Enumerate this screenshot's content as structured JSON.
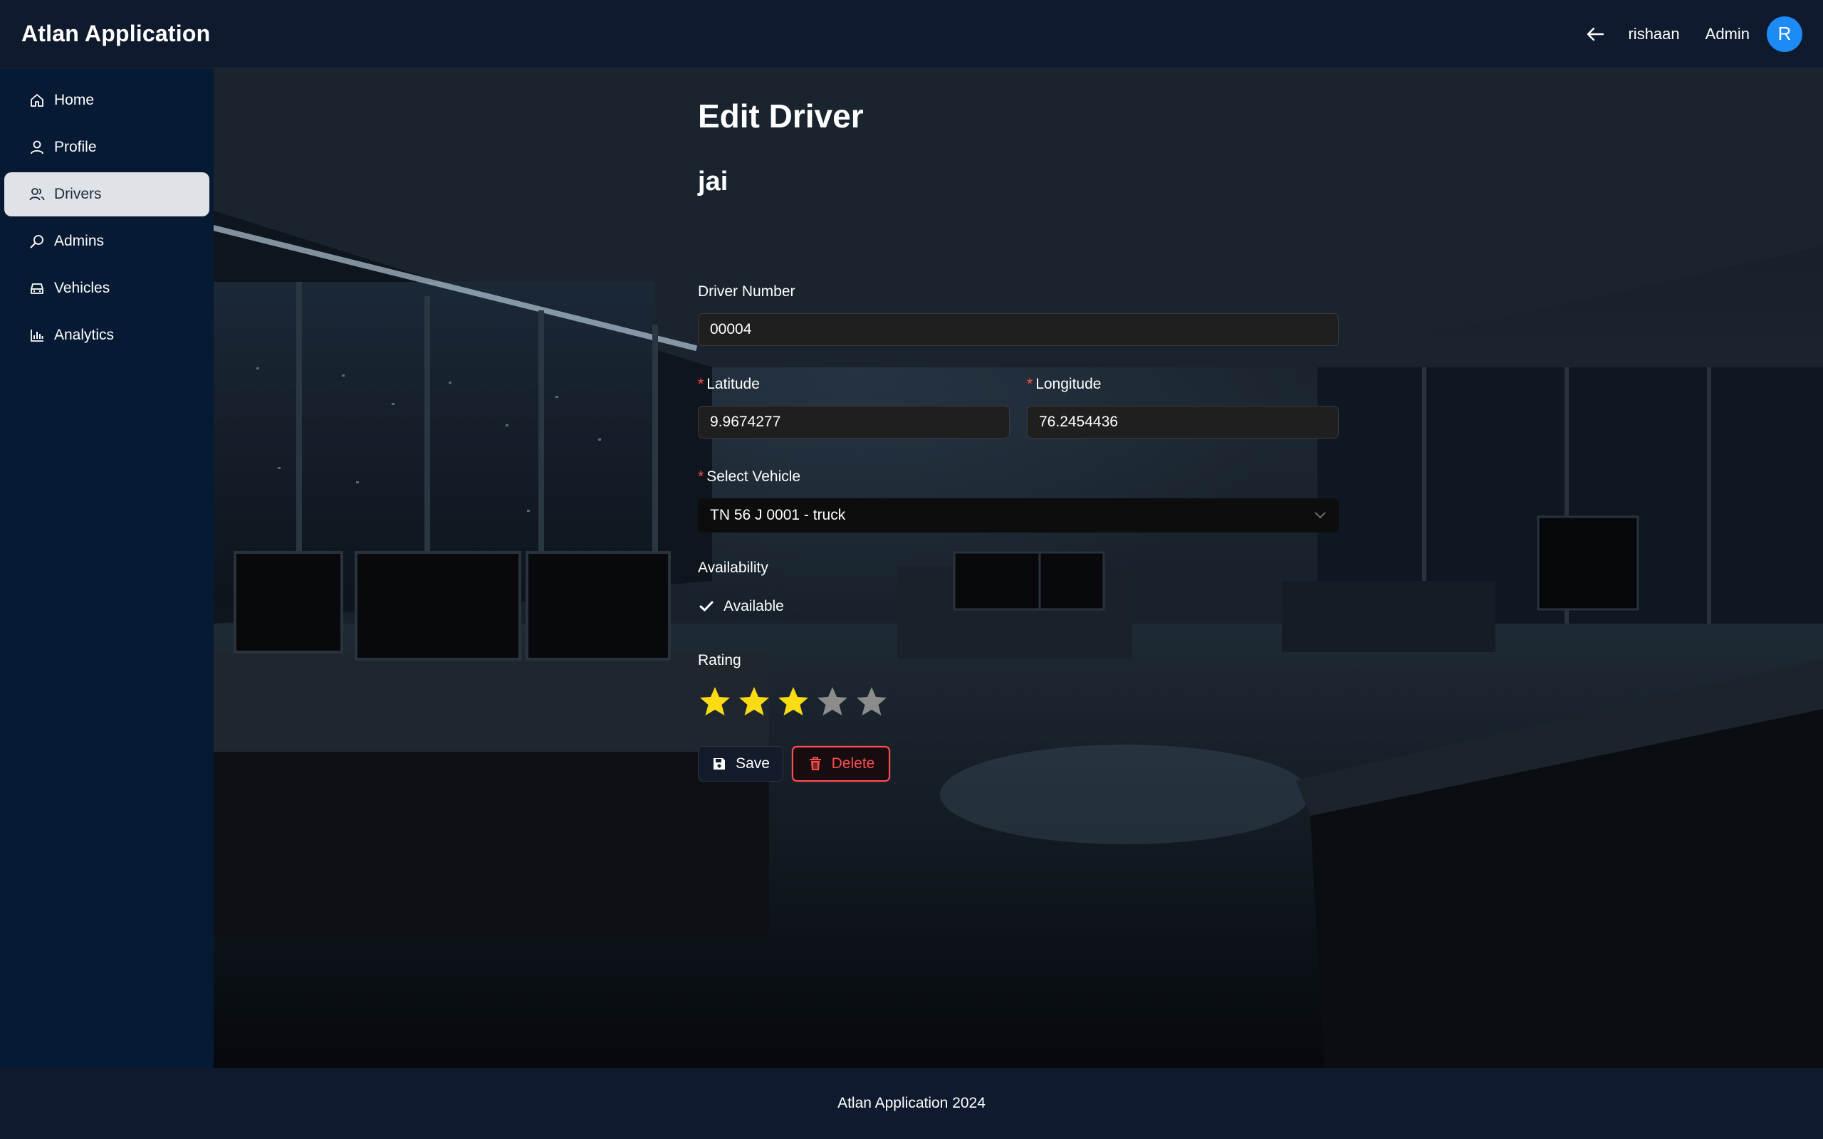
{
  "app": {
    "title": "Atlan Application"
  },
  "header": {
    "user_name": "rishaan",
    "user_role": "Admin",
    "avatar_initial": "R",
    "back_icon": "arrow-left-icon"
  },
  "sidebar": {
    "items": [
      {
        "label": "Home",
        "icon": "home-icon",
        "active": false
      },
      {
        "label": "Profile",
        "icon": "user-icon",
        "active": false
      },
      {
        "label": "Drivers",
        "icon": "users-icon",
        "active": true
      },
      {
        "label": "Admins",
        "icon": "search-user-icon",
        "active": false
      },
      {
        "label": "Vehicles",
        "icon": "car-icon",
        "active": false
      },
      {
        "label": "Analytics",
        "icon": "bar-chart-icon",
        "active": false
      }
    ]
  },
  "form": {
    "title": "Edit Driver",
    "driver_name": "jai",
    "driver_number": {
      "label": "Driver Number",
      "value": "00004"
    },
    "latitude": {
      "label": "Latitude",
      "value": "9.9674277",
      "required": true
    },
    "longitude": {
      "label": "Longitude",
      "value": "76.2454436",
      "required": true
    },
    "vehicle": {
      "label": "Select Vehicle",
      "value": "TN 56 J 0001 - truck",
      "required": true
    },
    "availability": {
      "label": "Availability",
      "option_label": "Available",
      "checked": true
    },
    "rating": {
      "label": "Rating",
      "value": 3,
      "max": 5
    },
    "save_label": "Save",
    "delete_label": "Delete"
  },
  "footer": {
    "text": "Atlan Application 2024"
  },
  "colors": {
    "accent": "#1c8bf5",
    "danger": "#ff4d4f",
    "star_filled": "#fadb14",
    "star_empty": "#8c8c8c",
    "header_bg": "#101a2e",
    "sidebar_bg": "#071a33"
  }
}
